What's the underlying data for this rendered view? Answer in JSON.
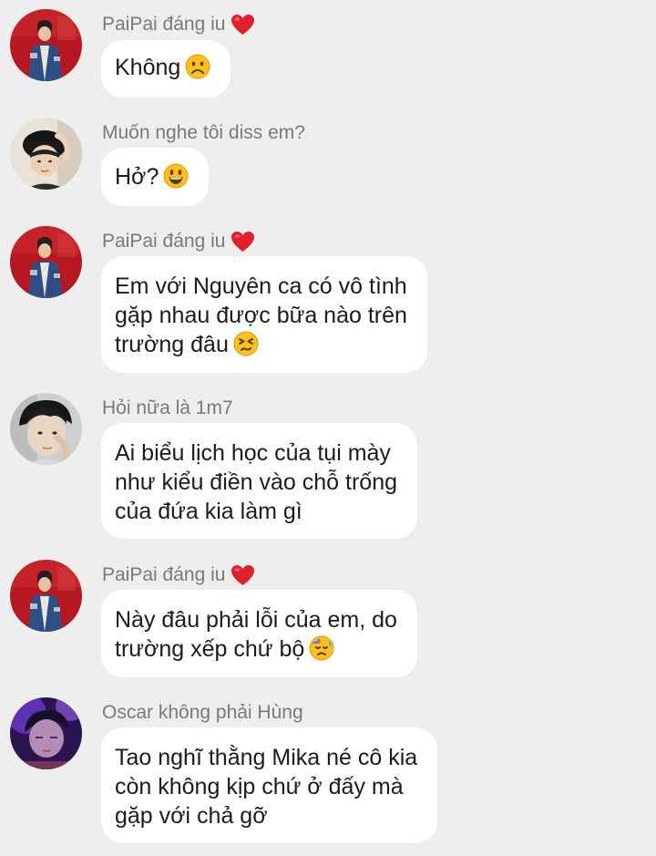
{
  "messages": [
    {
      "sender": "PaiPai đáng iu",
      "sender_heart": true,
      "avatar": "avatar-red-wall-jacket",
      "lines": [
        "Không"
      ],
      "emoji": "frowning-face-icon"
    },
    {
      "sender": "Muốn nghe tôi diss em?",
      "sender_heart": false,
      "avatar": "avatar-hat-boy",
      "lines": [
        "Hở?"
      ],
      "emoji": "grinning-face-icon"
    },
    {
      "sender": "PaiPai đáng iu",
      "sender_heart": true,
      "avatar": "avatar-red-wall-jacket",
      "lines": [
        "Em với Nguyên ca có vô tình",
        "gặp nhau được bữa nào trên",
        "trường đâu"
      ],
      "emoji": "persevering-face-icon"
    },
    {
      "sender": "Hỏi nữa là 1m7",
      "sender_heart": false,
      "avatar": "avatar-dark-hair-boy",
      "lines": [
        "Ai biểu lịch học của tụi mày",
        "như kiểu điền vào chỗ trống",
        "của đứa kia làm gì"
      ],
      "emoji": ""
    },
    {
      "sender": "PaiPai đáng iu",
      "sender_heart": true,
      "avatar": "avatar-red-wall-jacket",
      "lines": [
        "Này đâu phải lỗi của em, do",
        "trường xếp chứ bộ"
      ],
      "emoji": "downcast-sweat-face-icon"
    },
    {
      "sender": "Oscar không phải Hùng",
      "sender_heart": false,
      "avatar": "avatar-purple-light-boy",
      "lines": [
        "Tao nghĩ thằng Mika né cô kia",
        "còn không kịp chứ ở đấy mà",
        "gặp với chả gỡ"
      ],
      "emoji": ""
    }
  ],
  "colors": {
    "background": "#eeeeee",
    "bubble": "#ffffff",
    "sender_text": "#7a7a7a",
    "message_text": "#1c1c1c",
    "heart": "#e0202a"
  }
}
